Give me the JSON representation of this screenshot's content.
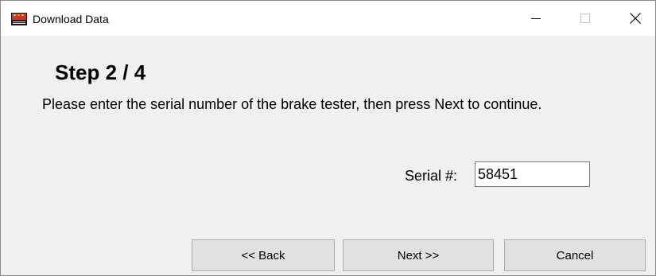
{
  "window": {
    "title": "Download Data",
    "icon": "brake-tester-app-icon"
  },
  "titlebar_controls": {
    "minimize_icon": "minimize-icon",
    "maximize_icon": "maximize-icon",
    "close_icon": "close-icon"
  },
  "content": {
    "heading": "Step 2 / 4",
    "instructions": "Please enter the serial number of the brake tester, then press Next to continue.",
    "serial_label": "Serial #:",
    "serial_value": "58451"
  },
  "buttons": {
    "back_label": "<< Back",
    "next_label": "Next >>",
    "cancel_label": "Cancel"
  },
  "colors": {
    "dialog_background": "#f0f0f0",
    "titlebar_background": "#ffffff",
    "button_background": "#e1e1e1",
    "button_border": "#adadad"
  }
}
